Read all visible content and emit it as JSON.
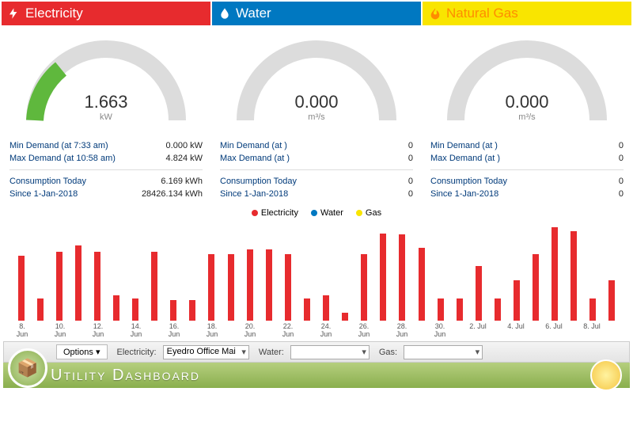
{
  "panels": {
    "electricity": {
      "title": "Electricity",
      "gauge_value": "1.663",
      "gauge_unit": "kW",
      "min_label": "Min Demand (at 7:33 am)",
      "min_value": "0.000 kW",
      "max_label": "Max Demand (at 10:58 am)",
      "max_value": "4.824 kW",
      "today_label": "Consumption Today",
      "today_value": "6.169 kWh",
      "since_label": "Since 1-Jan-2018",
      "since_value": "28426.134 kWh"
    },
    "water": {
      "title": "Water",
      "gauge_value": "0.000",
      "gauge_unit": "m³/s",
      "min_label": "Min Demand (at )",
      "min_value": "0",
      "max_label": "Max Demand (at )",
      "max_value": "0",
      "today_label": "Consumption Today",
      "today_value": "0",
      "since_label": "Since 1-Jan-2018",
      "since_value": "0"
    },
    "gas": {
      "title": "Natural Gas",
      "gauge_value": "0.000",
      "gauge_unit": "m³/s",
      "min_label": "Min Demand (at )",
      "min_value": "0",
      "max_label": "Max Demand (at )",
      "max_value": "0",
      "today_label": "Consumption Today",
      "today_value": "0",
      "since_label": "Since 1-Jan-2018",
      "since_value": "0"
    }
  },
  "legend": {
    "elec": "Electricity",
    "water": "Water",
    "gas": "Gas"
  },
  "chart_data": {
    "type": "bar",
    "title": "",
    "xlabel": "",
    "ylabel": "",
    "ylim": [
      0,
      100
    ],
    "categories": [
      "8. Jun",
      "",
      "10. Jun",
      "",
      "12. Jun",
      "",
      "14. Jun",
      "",
      "16. Jun",
      "",
      "18. Jun",
      "",
      "20. Jun",
      "",
      "22. Jun",
      "",
      "24. Jun",
      "",
      "26. Jun",
      "",
      "28. Jun",
      "",
      "30. Jun",
      "",
      "2. Jul",
      "",
      "4. Jul",
      "",
      "6. Jul",
      "",
      "8. Jul",
      ""
    ],
    "series": [
      {
        "name": "Electricity",
        "color": "#e72b2e",
        "values": [
          64,
          22,
          68,
          74,
          68,
          25,
          22,
          68,
          20,
          20,
          66,
          66,
          70,
          70,
          66,
          22,
          25,
          8,
          66,
          86,
          85,
          72,
          22,
          22,
          54,
          22,
          40,
          66,
          92,
          88,
          22,
          40
        ]
      },
      {
        "name": "Water",
        "color": "#0078c1",
        "values": []
      },
      {
        "name": "Gas",
        "color": "#f9e500",
        "values": []
      }
    ]
  },
  "toolbar": {
    "options": "Options ▾",
    "elec_label": "Electricity:",
    "elec_value": "Eyedro Office Mai",
    "water_label": "Water:",
    "water_value": "",
    "gas_label": "Gas:",
    "gas_value": ""
  },
  "footer": {
    "title": "Utility Dashboard"
  },
  "colors": {
    "elec": "#e72b2e",
    "water": "#0078c1",
    "gas": "#f9e500"
  }
}
